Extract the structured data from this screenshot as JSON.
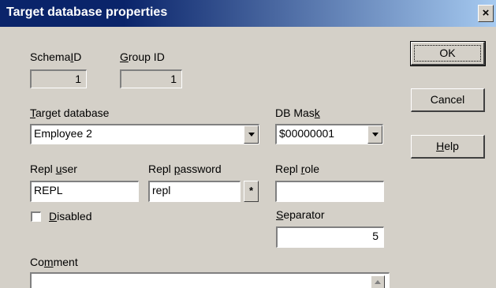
{
  "window": {
    "title": "Target database properties",
    "close_glyph": "×"
  },
  "schema_id": {
    "label_pre": "Schema",
    "label_ul": "I",
    "label_post": "D",
    "value": "1"
  },
  "group_id": {
    "label_pre": "",
    "label_ul": "G",
    "label_post": "roup ID",
    "value": "1"
  },
  "target_db": {
    "label_pre": "",
    "label_ul": "T",
    "label_post": "arget database",
    "value": "Employee 2"
  },
  "db_mask": {
    "label_pre": "DB Mas",
    "label_ul": "k",
    "label_post": "",
    "value": "$00000001"
  },
  "repl_user": {
    "label_pre": "Repl ",
    "label_ul": "u",
    "label_post": "ser",
    "value": "REPL"
  },
  "repl_password": {
    "label_pre": "Repl ",
    "label_ul": "p",
    "label_post": "assword",
    "value": "repl",
    "button_glyph": "*"
  },
  "repl_role": {
    "label_pre": "Repl ",
    "label_ul": "r",
    "label_post": "ole",
    "value": ""
  },
  "disabled": {
    "label_pre": "",
    "label_ul": "D",
    "label_post": "isabled",
    "checked": false
  },
  "separator": {
    "label_pre": "",
    "label_ul": "S",
    "label_post": "eparator",
    "value": "5"
  },
  "comment": {
    "label_pre": "Co",
    "label_ul": "m",
    "label_post": "ment",
    "value": ""
  },
  "buttons": {
    "ok": "OK",
    "cancel": "Cancel",
    "help_ul": "H",
    "help_post": "elp"
  },
  "colors": {
    "face": "#d4d0c8",
    "title_start": "#0a246a",
    "title_end": "#a6caf0"
  }
}
